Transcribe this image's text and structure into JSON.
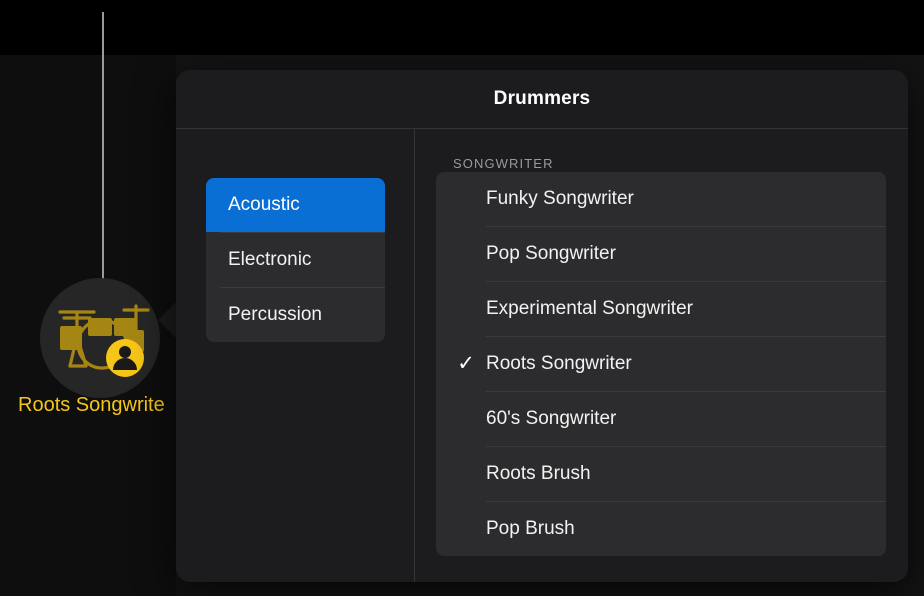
{
  "track": {
    "name_label": "Roots Songwrite",
    "name_color": "#f5c518",
    "icon": "drum-kit-with-person-badge-icon",
    "playhead": "playhead-line"
  },
  "popover": {
    "title": "Drummers",
    "section_label": "SONGWRITER",
    "accent_color": "#0a6fd4",
    "categories": [
      {
        "label": "Acoustic",
        "selected": true
      },
      {
        "label": "Electronic",
        "selected": false
      },
      {
        "label": "Percussion",
        "selected": false
      }
    ],
    "drummers": [
      {
        "label": "Funky Songwriter",
        "checked": false
      },
      {
        "label": "Pop Songwriter",
        "checked": false
      },
      {
        "label": "Experimental Songwriter",
        "checked": false
      },
      {
        "label": "Roots Songwriter",
        "checked": true
      },
      {
        "label": "60's Songwriter",
        "checked": false
      },
      {
        "label": "Roots Brush",
        "checked": false
      },
      {
        "label": "Pop Brush",
        "checked": false
      }
    ],
    "checkmark_glyph": "✓"
  }
}
